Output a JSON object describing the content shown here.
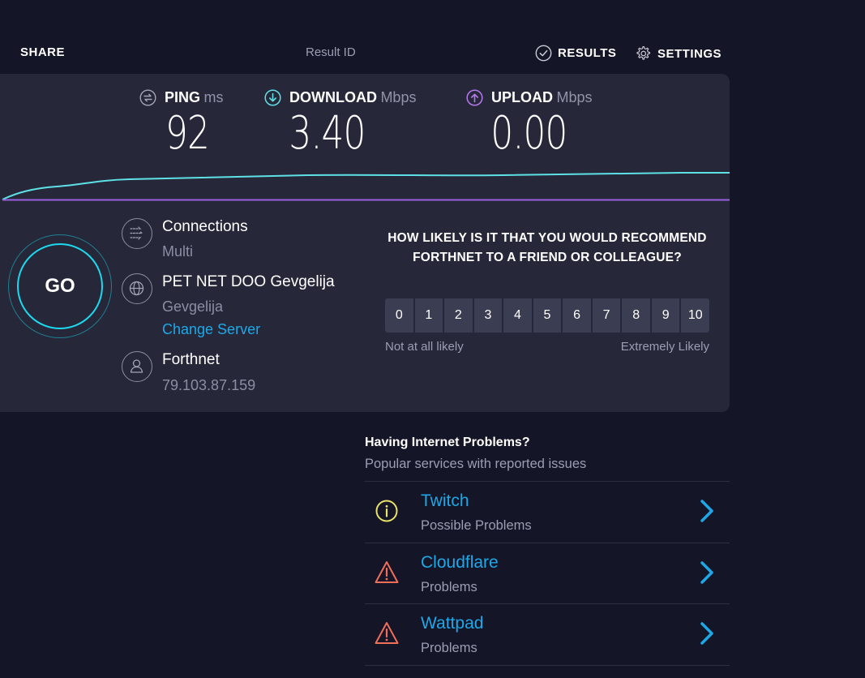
{
  "topbar": {
    "share": "SHARE",
    "result_id": "Result ID",
    "results": "RESULTS",
    "settings": "SETTINGS"
  },
  "metrics": {
    "ping": {
      "label": "PING",
      "unit": "ms",
      "value": "92"
    },
    "download": {
      "label": "DOWNLOAD",
      "unit": "Mbps",
      "value": "3.40"
    },
    "upload": {
      "label": "UPLOAD",
      "unit": "Mbps",
      "value": "0.00"
    }
  },
  "go_button": "GO",
  "info": {
    "connections": {
      "title": "Connections",
      "sub": "Multi"
    },
    "server": {
      "title": "PET NET DOO Gevgelija",
      "sub": "Gevgelija",
      "link": "Change Server"
    },
    "provider": {
      "title": "Forthnet",
      "sub": "79.103.87.159"
    }
  },
  "nps": {
    "question": "HOW LIKELY IS IT THAT YOU WOULD RECOMMEND FORTHNET TO A FRIEND OR COLLEAGUE?",
    "scale": [
      "0",
      "1",
      "2",
      "3",
      "4",
      "5",
      "6",
      "7",
      "8",
      "9",
      "10"
    ],
    "low_label": "Not at all likely",
    "high_label": "Extremely Likely"
  },
  "problems": {
    "title": "Having Internet Problems?",
    "subtitle": "Popular services with reported issues",
    "items": [
      {
        "name": "Twitch",
        "status": "Possible Problems",
        "icon": "info-icon"
      },
      {
        "name": "Cloudflare",
        "status": "Problems",
        "icon": "warning-icon"
      },
      {
        "name": "Wattpad",
        "status": "Problems",
        "icon": "warning-icon"
      }
    ]
  },
  "colors": {
    "background": "#141526",
    "panel": "#262839",
    "download_accent": "#5ee1e6",
    "upload_accent": "#9a5fe0",
    "link": "#1ea8e8",
    "info_yellow": "#e9e36a",
    "warning_red": "#ef6e5a"
  }
}
